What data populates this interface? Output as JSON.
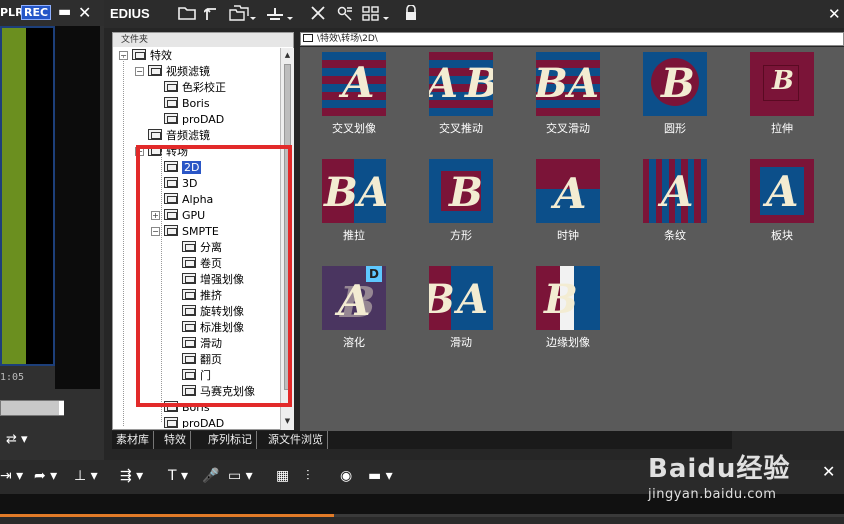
{
  "preview": {
    "plr_label": "PLR",
    "rec_label": "REC",
    "minimize": "▬",
    "close": "✕",
    "timecode": "1:05",
    "tool_icon": "⇄ ▾"
  },
  "app": {
    "title": "EDIUS",
    "close": "✕",
    "toolbar_icons": [
      "folder-icon",
      "up-folder-icon",
      "copy-folder-icon",
      "layer-icon",
      "delete-icon",
      "properties-icon",
      "view-icon",
      "lock-icon"
    ]
  },
  "folder_panel": {
    "header": "文件夹",
    "tree": [
      {
        "label": "特效",
        "level": 0,
        "expander": "−"
      },
      {
        "label": "视频滤镜",
        "level": 1,
        "expander": "−"
      },
      {
        "label": "色彩校正",
        "level": 2,
        "expander": ""
      },
      {
        "label": "Boris",
        "level": 2,
        "expander": ""
      },
      {
        "label": "proDAD",
        "level": 2,
        "expander": ""
      },
      {
        "label": "音频滤镜",
        "level": 1,
        "expander": ""
      },
      {
        "label": "转场",
        "level": 1,
        "expander": "−"
      },
      {
        "label": "2D",
        "level": 2,
        "expander": "",
        "selected": true
      },
      {
        "label": "3D",
        "level": 2,
        "expander": ""
      },
      {
        "label": "Alpha",
        "level": 2,
        "expander": ""
      },
      {
        "label": "GPU",
        "level": 2,
        "expander": "+"
      },
      {
        "label": "SMPTE",
        "level": 2,
        "expander": "−"
      },
      {
        "label": "分离",
        "level": 3,
        "expander": ""
      },
      {
        "label": "卷页",
        "level": 3,
        "expander": ""
      },
      {
        "label": "增强划像",
        "level": 3,
        "expander": ""
      },
      {
        "label": "推挤",
        "level": 3,
        "expander": ""
      },
      {
        "label": "旋转划像",
        "level": 3,
        "expander": ""
      },
      {
        "label": "标准划像",
        "level": 3,
        "expander": ""
      },
      {
        "label": "滑动",
        "level": 3,
        "expander": ""
      },
      {
        "label": "翻页",
        "level": 3,
        "expander": ""
      },
      {
        "label": "门",
        "level": 3,
        "expander": ""
      },
      {
        "label": "马赛克划像",
        "level": 3,
        "expander": ""
      },
      {
        "label": "Boris",
        "level": 2,
        "expander": ""
      },
      {
        "label": "proDAD",
        "level": 2,
        "expander": ""
      }
    ]
  },
  "tabs": [
    "素材库",
    "特效",
    "序列标记",
    "源文件浏览"
  ],
  "content": {
    "path": "\\特效\\转场\\2D\\",
    "items": [
      {
        "label": "交叉划像",
        "style": "stripes-h",
        "letter": "A"
      },
      {
        "label": "交叉推动",
        "style": "stripes-mix",
        "letter": "B"
      },
      {
        "label": "交叉滑动",
        "style": "stripes-mix2",
        "letter": "A"
      },
      {
        "label": "圆形",
        "style": "circle",
        "letter": "B"
      },
      {
        "label": "拉伸",
        "style": "stretch",
        "letter": "B"
      },
      {
        "label": "推拉",
        "style": "push",
        "letter": "B"
      },
      {
        "label": "方形",
        "style": "square",
        "letter": "B"
      },
      {
        "label": "时钟",
        "style": "clock",
        "letter": "A"
      },
      {
        "label": "条纹",
        "style": "stripes-v",
        "letter": "A"
      },
      {
        "label": "板块",
        "style": "block",
        "letter": "A"
      },
      {
        "label": "溶化",
        "style": "dissolve",
        "letter": "A",
        "badge": "D"
      },
      {
        "label": "滑动",
        "style": "slide",
        "letter": "B"
      },
      {
        "label": "边缘划像",
        "style": "edge",
        "letter": "B"
      }
    ]
  },
  "colors": {
    "clip_a": "#0c4f8a",
    "clip_b": "#7b1438",
    "highlight": "#e22a2a",
    "selection": "#2a56c6",
    "preview_green": "#6b8f1f"
  },
  "bottom": {
    "close": "✕",
    "tools": [
      "⇥ ▾",
      "➦ ▾",
      "⊥ ▾",
      "⇶ ▾",
      "T ▾",
      "🎤",
      "▭ ▾",
      "▦",
      "⫶",
      "◉",
      "▬ ▾"
    ]
  },
  "watermark": {
    "logo": "Baidu经验",
    "url": "jingyan.baidu.com"
  }
}
